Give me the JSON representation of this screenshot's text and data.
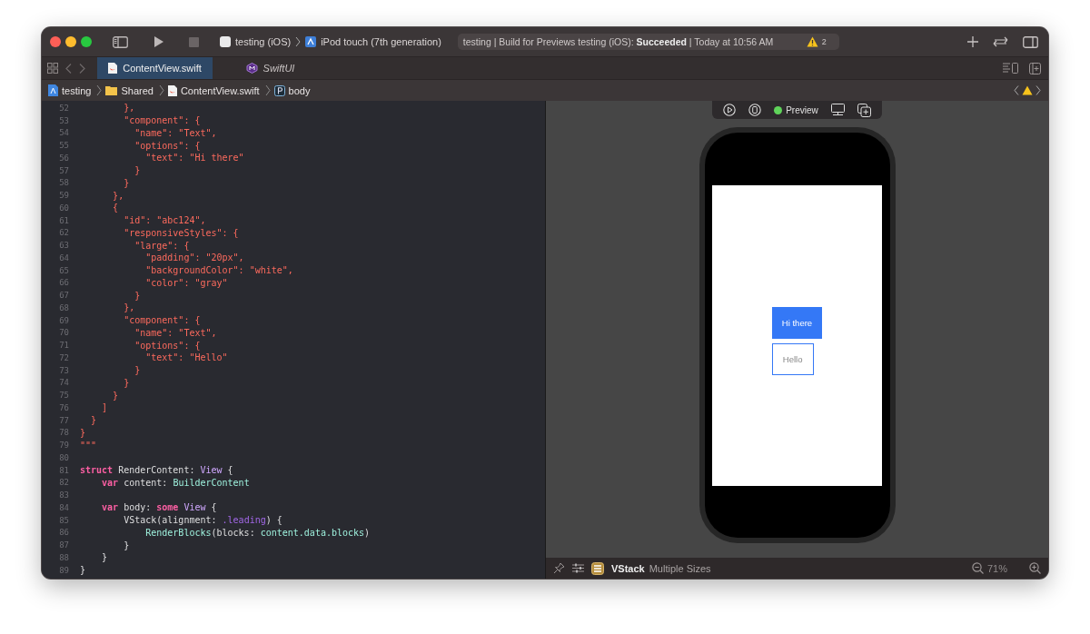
{
  "toolbar": {
    "scheme": "testing (iOS)",
    "device": "iPod touch (7th generation)",
    "status": "testing | Build for Previews testing (iOS): **Succeeded** | Today at 10:56 AM",
    "warning_count": "2"
  },
  "tabs": [
    {
      "label": "ContentView.swift",
      "kind": "swift",
      "selected": true
    },
    {
      "label": "SwiftUI",
      "kind": "module",
      "selected": false
    }
  ],
  "breadcrumb": [
    {
      "label": "testing",
      "kind": "project"
    },
    {
      "label": "Shared",
      "kind": "folder"
    },
    {
      "label": "ContentView.swift",
      "kind": "swift"
    },
    {
      "label": "body",
      "kind": "property"
    }
  ],
  "editor": {
    "lines": [
      {
        "num": "52",
        "tokens": [
          {
            "kind": "string",
            "text": "        },"
          }
        ]
      },
      {
        "num": "53",
        "tokens": [
          {
            "kind": "string",
            "text": "        \"component\": {"
          }
        ]
      },
      {
        "num": "54",
        "tokens": [
          {
            "kind": "string",
            "text": "          \"name\": \"Text\","
          }
        ]
      },
      {
        "num": "55",
        "tokens": [
          {
            "kind": "string",
            "text": "          \"options\": {"
          }
        ]
      },
      {
        "num": "56",
        "tokens": [
          {
            "kind": "string",
            "text": "            \"text\": \"Hi there\""
          }
        ]
      },
      {
        "num": "57",
        "tokens": [
          {
            "kind": "string",
            "text": "          }"
          }
        ]
      },
      {
        "num": "58",
        "tokens": [
          {
            "kind": "string",
            "text": "        }"
          }
        ]
      },
      {
        "num": "59",
        "tokens": [
          {
            "kind": "string",
            "text": "      },"
          }
        ]
      },
      {
        "num": "60",
        "tokens": [
          {
            "kind": "string",
            "text": "      {"
          }
        ]
      },
      {
        "num": "61",
        "tokens": [
          {
            "kind": "string",
            "text": "        \"id\": \"abc124\","
          }
        ]
      },
      {
        "num": "62",
        "tokens": [
          {
            "kind": "string",
            "text": "        \"responsiveStyles\": {"
          }
        ]
      },
      {
        "num": "63",
        "tokens": [
          {
            "kind": "string",
            "text": "          \"large\": {"
          }
        ]
      },
      {
        "num": "64",
        "tokens": [
          {
            "kind": "string",
            "text": "            \"padding\": \"20px\","
          }
        ]
      },
      {
        "num": "65",
        "tokens": [
          {
            "kind": "string",
            "text": "            \"backgroundColor\": \"white\","
          }
        ]
      },
      {
        "num": "66",
        "tokens": [
          {
            "kind": "string",
            "text": "            \"color\": \"gray\""
          }
        ]
      },
      {
        "num": "67",
        "tokens": [
          {
            "kind": "string",
            "text": "          }"
          }
        ]
      },
      {
        "num": "68",
        "tokens": [
          {
            "kind": "string",
            "text": "        },"
          }
        ]
      },
      {
        "num": "69",
        "tokens": [
          {
            "kind": "string",
            "text": "        \"component\": {"
          }
        ]
      },
      {
        "num": "70",
        "tokens": [
          {
            "kind": "string",
            "text": "          \"name\": \"Text\","
          }
        ]
      },
      {
        "num": "71",
        "tokens": [
          {
            "kind": "string",
            "text": "          \"options\": {"
          }
        ]
      },
      {
        "num": "72",
        "tokens": [
          {
            "kind": "string",
            "text": "            \"text\": \"Hello\""
          }
        ]
      },
      {
        "num": "73",
        "tokens": [
          {
            "kind": "string",
            "text": "          }"
          }
        ]
      },
      {
        "num": "74",
        "tokens": [
          {
            "kind": "string",
            "text": "        }"
          }
        ]
      },
      {
        "num": "75",
        "tokens": [
          {
            "kind": "string",
            "text": "      }"
          }
        ]
      },
      {
        "num": "76",
        "tokens": [
          {
            "kind": "string",
            "text": "    ]"
          }
        ]
      },
      {
        "num": "77",
        "tokens": [
          {
            "kind": "string",
            "text": "  }"
          }
        ]
      },
      {
        "num": "78",
        "tokens": [
          {
            "kind": "string",
            "text": "}"
          }
        ]
      },
      {
        "num": "79",
        "tokens": [
          {
            "kind": "string",
            "text": "\"\"\""
          }
        ]
      },
      {
        "num": "80"
      },
      {
        "num": "81",
        "tokens": [
          {
            "kind": "keyword",
            "text": "struct"
          },
          {
            "kind": "plain",
            "text": " RenderContent: "
          },
          {
            "kind": "type",
            "text": "View"
          },
          {
            "kind": "plain",
            "text": " {"
          }
        ]
      },
      {
        "num": "82",
        "tokens": [
          {
            "kind": "keyword",
            "text": "    var"
          },
          {
            "kind": "plain",
            "text": " content: "
          },
          {
            "kind": "project",
            "text": "BuilderContent"
          }
        ]
      },
      {
        "num": "83"
      },
      {
        "num": "84",
        "tokens": [
          {
            "kind": "keyword",
            "text": "    var"
          },
          {
            "kind": "plain",
            "text": " body: "
          },
          {
            "kind": "keyword",
            "text": "some"
          },
          {
            "kind": "type",
            "text": " View"
          },
          {
            "kind": "plain",
            "text": " {"
          }
        ]
      },
      {
        "num": "85",
        "tokens": [
          {
            "kind": "plain",
            "text": "        VStack(alignment: "
          },
          {
            "kind": "member",
            "text": ".leading"
          },
          {
            "kind": "plain",
            "text": ") {"
          }
        ]
      },
      {
        "num": "86",
        "tokens": [
          {
            "kind": "project",
            "text": "            RenderBlocks"
          },
          {
            "kind": "plain",
            "text": "(blocks: "
          },
          {
            "kind": "project",
            "text": "content.data.blocks"
          },
          {
            "kind": "plain",
            "text": ")"
          }
        ]
      },
      {
        "num": "87",
        "tokens": [
          {
            "kind": "plain",
            "text": "        }"
          }
        ]
      },
      {
        "num": "88",
        "tokens": [
          {
            "kind": "plain",
            "text": "    }"
          }
        ]
      },
      {
        "num": "89",
        "tokens": [
          {
            "kind": "plain",
            "text": "}"
          }
        ]
      }
    ]
  },
  "preview": {
    "mode": "Preview",
    "blocks": [
      {
        "kind": "filled",
        "text": "Hi there"
      },
      {
        "kind": "outlined",
        "text": "Hello"
      }
    ],
    "selection": {
      "name": "VStack",
      "detail": "Multiple Sizes"
    },
    "zoom": "71%"
  }
}
